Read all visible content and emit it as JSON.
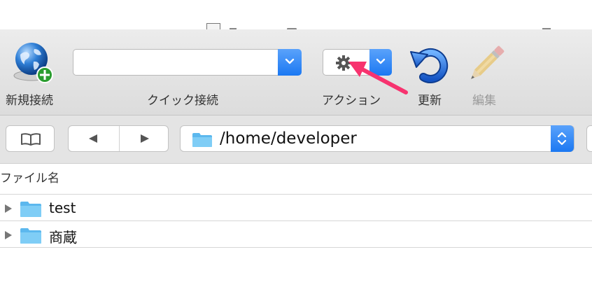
{
  "toolbar": {
    "new_connection_label": "新規接続",
    "quick_connect_label": "クイック接続",
    "quick_connect_value": "",
    "action_label": "アクション",
    "refresh_label": "更新",
    "edit_label": "編集",
    "edit_enabled": false,
    "accent_color": "#1b78f2"
  },
  "navigation": {
    "path": "/home/developer"
  },
  "browser": {
    "column_header": "ファイル名",
    "rows": [
      {
        "name": "test",
        "type": "folder",
        "expanded": false
      },
      {
        "name": "商蔵",
        "type": "folder",
        "expanded": false
      }
    ]
  },
  "annotation": {
    "arrow_color": "#f7336f",
    "points_to": "action-button"
  }
}
